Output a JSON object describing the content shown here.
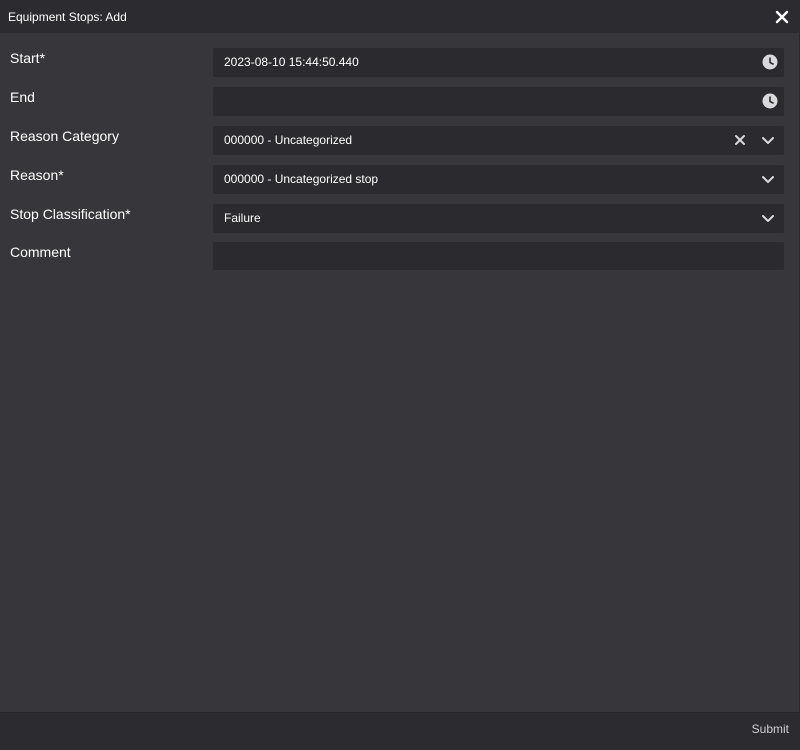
{
  "dialog": {
    "title": "Equipment Stops: Add",
    "close_icon": "close-icon",
    "fields": {
      "start": {
        "label": "Start*",
        "value": "2023-08-10 15:44:50.440",
        "icon": "clock-icon"
      },
      "end": {
        "label": "End",
        "value": "",
        "icon": "clock-icon"
      },
      "reason_category": {
        "label": "Reason Category",
        "value": "000000 - Uncategorized",
        "icons": [
          "clear-icon",
          "chevron-down-icon"
        ]
      },
      "reason": {
        "label": "Reason*",
        "value": "000000 - Uncategorized stop",
        "icon": "chevron-down-icon"
      },
      "stop_classification": {
        "label": "Stop Classification*",
        "value": "Failure",
        "icon": "chevron-down-icon"
      },
      "comment": {
        "label": "Comment",
        "value": ""
      }
    },
    "footer": {
      "submit_label": "Submit"
    }
  },
  "colors": {
    "background": "#37373b",
    "titlebar": "#2c2c30",
    "field": "#2b2b2f",
    "text": "#ffffff",
    "icon": "#d9d9dc"
  }
}
